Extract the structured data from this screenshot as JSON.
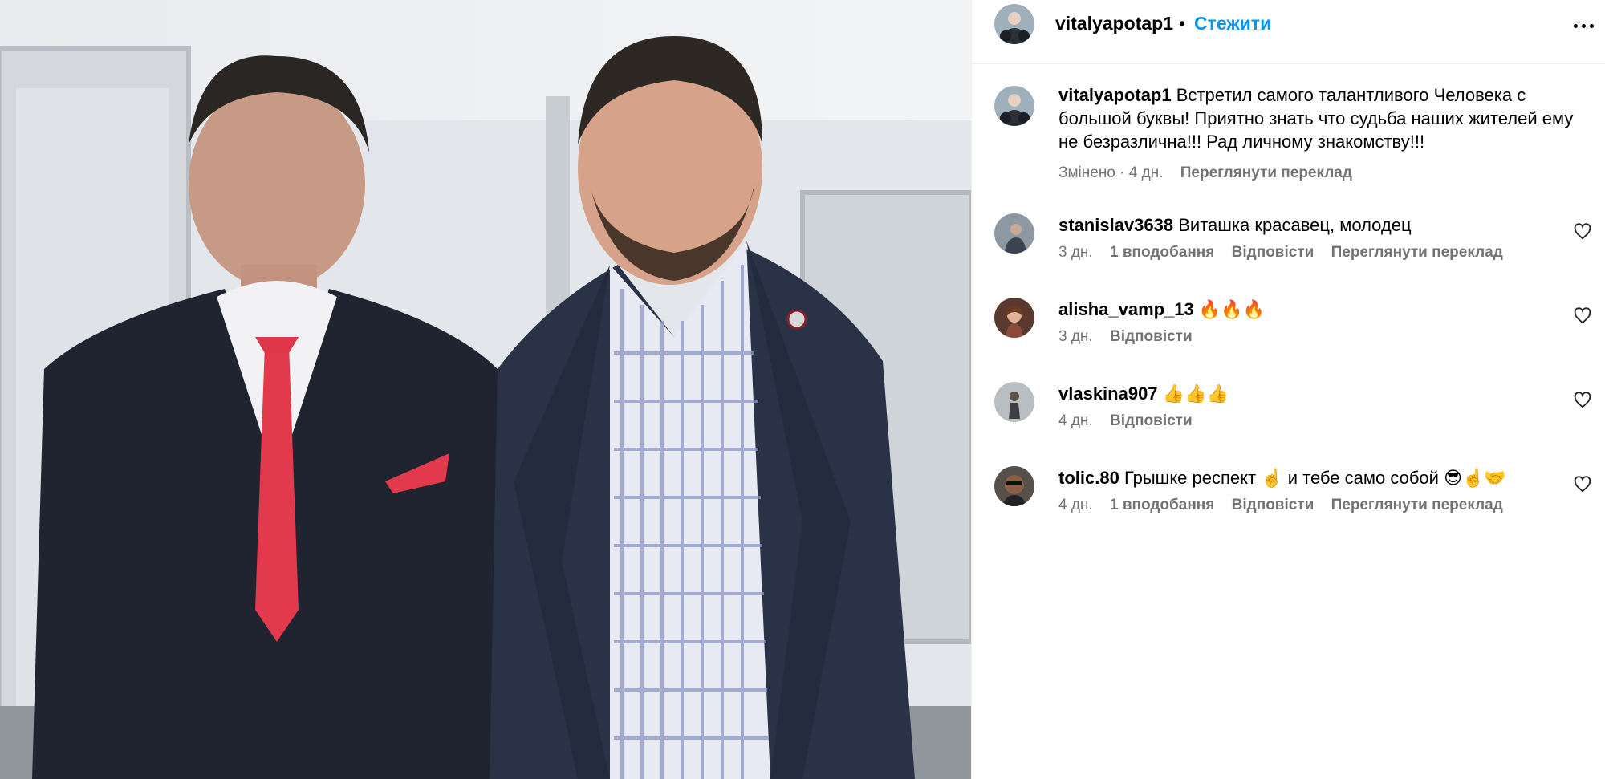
{
  "post": {
    "username": "vitalyapotap1",
    "separator": "•",
    "follow_label": "Стежити",
    "more_icon": "more-horizontal-icon",
    "caption": {
      "username": "vitalyapotap1",
      "text": "Встретил самого талантливого Человека с большой буквы! Приятно знать что судьба наших жителей ему не безразлична!!! Рад личному знакомству!!!",
      "meta_time": "Змінено · 4 дн.",
      "translate_label": "Переглянути переклад"
    }
  },
  "comments": [
    {
      "username": "stanislav3638",
      "text": "Виташка красавец, молодец",
      "time": "3 дн.",
      "likes": "1 вподобання",
      "reply": "Відповісти",
      "translate": "Переглянути переклад"
    },
    {
      "username": "alisha_vamp_13",
      "text": "🔥🔥🔥",
      "time": "3 дн.",
      "reply": "Відповісти"
    },
    {
      "username": "vlaskina907",
      "text": "👍👍👍",
      "time": "4 дн.",
      "reply": "Відповісти"
    },
    {
      "username": "tolic.80",
      "text": "Грышке респект ☝️ и тебе само собой 😎☝️🤝",
      "time": "4 дн.",
      "likes": "1 вподобання",
      "reply": "Відповісти",
      "translate": "Переглянути переклад"
    }
  ],
  "colors": {
    "link_blue": "#0095f6",
    "secondary_text": "#737373",
    "divider": "#efefef"
  }
}
